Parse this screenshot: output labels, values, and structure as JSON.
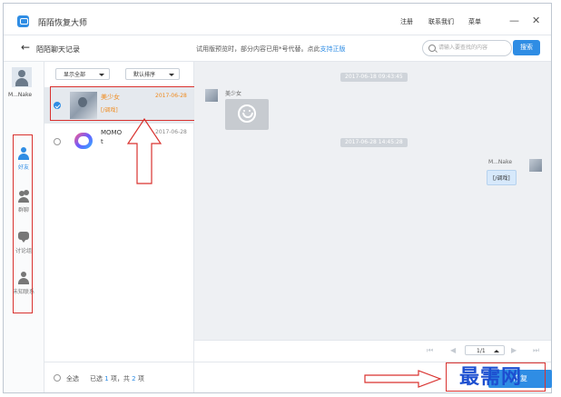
{
  "app": {
    "title": "陌陌恢复大师"
  },
  "titlebar": {
    "register": "注册",
    "contact": "联系我们",
    "menu": "菜单",
    "minimize": "—",
    "close": "✕"
  },
  "subbar": {
    "back": "←",
    "title": "陌陌聊天记录",
    "notice": "试用版预览时，部分内容已用*号代替。点此",
    "notice_link": "支持正版",
    "search_placeholder": "请输入要查找的内容",
    "search_button": "搜索"
  },
  "sidebar": {
    "username": "M...Nake",
    "items": [
      {
        "label": "好友",
        "icon": "person-icon",
        "active": true
      },
      {
        "label": "群聊",
        "icon": "group-icon",
        "active": false
      },
      {
        "label": "讨论组",
        "icon": "bubble-icon",
        "active": false
      },
      {
        "label": "未知联系",
        "icon": "person-icon",
        "active": false
      }
    ]
  },
  "list": {
    "filter": "显示全部",
    "sort": "默认排序",
    "rows": [
      {
        "name": "美少女",
        "date": "2017-06-28",
        "preview": "[/调戏]",
        "selected": true
      },
      {
        "name": "MOMO",
        "name_line2": "t",
        "date": "2017-06-28",
        "preview": "",
        "selected": false
      }
    ]
  },
  "chat": {
    "stamps": [
      "2017-06-18 09:43:45",
      "2017-06-28 14:45:28"
    ],
    "left_name": "美少女",
    "right_name": "M...Nake",
    "right_message": "[/调戏]"
  },
  "pager": {
    "first": "⏮",
    "prev": "◀",
    "page": "1/1",
    "next": "▶",
    "last": "⏭"
  },
  "footer": {
    "select_all": "全选",
    "selected_prefix": "已选 ",
    "selected_count": "1",
    "selected_mid": " 项，共 ",
    "total": "2",
    "selected_suffix": " 项",
    "restore": "恢复"
  },
  "watermark": "最需网",
  "colors": {
    "accent": "#2f8de4",
    "highlight": "#f08a1c",
    "annotation": "#d9322f"
  }
}
